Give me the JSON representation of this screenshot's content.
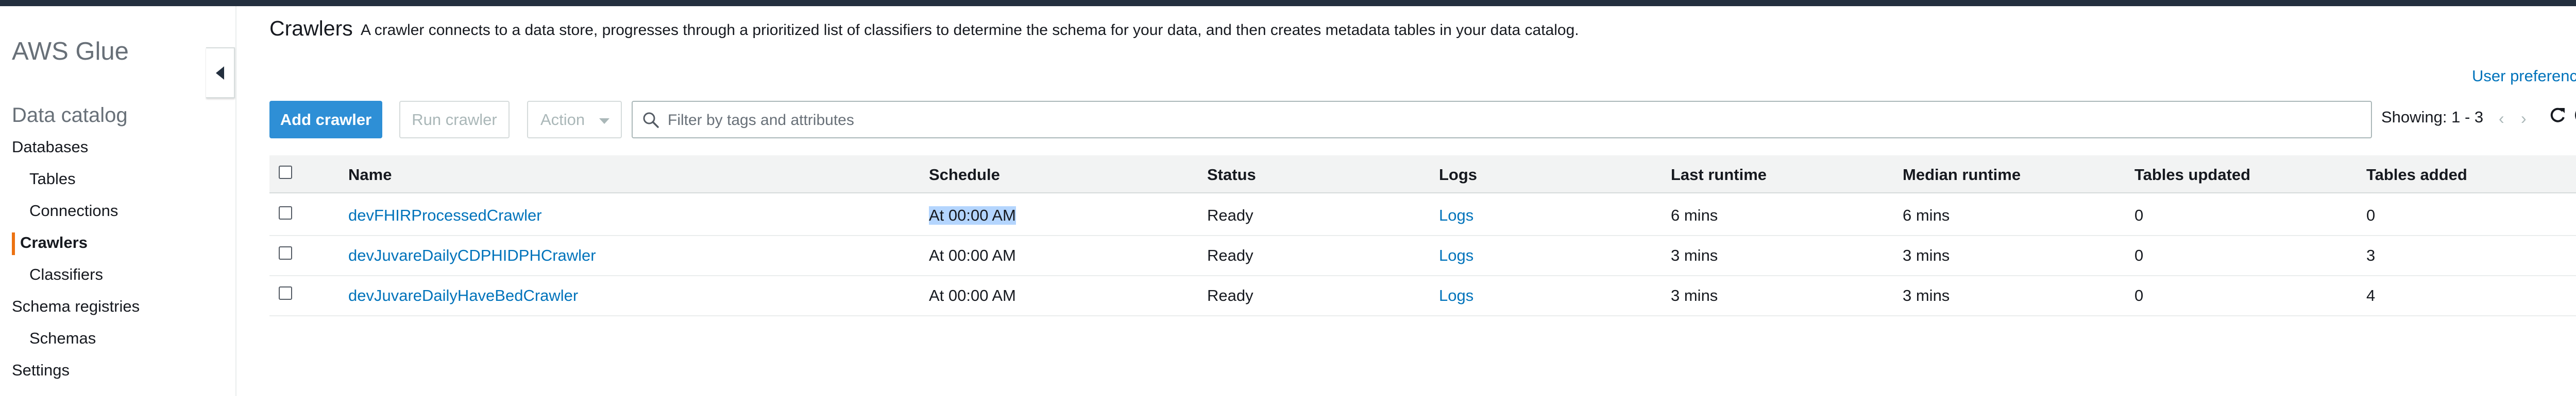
{
  "sidebar": {
    "brand": "AWS Glue",
    "section_title": "Data catalog",
    "items": [
      {
        "label": "Databases"
      },
      {
        "label": "Tables"
      },
      {
        "label": "Connections"
      },
      {
        "label": "Crawlers"
      },
      {
        "label": "Classifiers"
      },
      {
        "label": "Schema registries"
      },
      {
        "label": "Schemas"
      },
      {
        "label": "Settings"
      }
    ],
    "active_item": "Crawlers",
    "accent_color": "#ec7211"
  },
  "header": {
    "title": "Crawlers",
    "description": "A crawler connects to a data store, progresses through a prioritized list of classifiers to determine the schema for your data, and then creates metadata tables in your data catalog.",
    "user_preferences": "User preferences"
  },
  "toolbar": {
    "add_label": "Add crawler",
    "run_label": "Run crawler",
    "action_label": "Action",
    "search_placeholder": "Filter by tags and attributes",
    "search_value": "",
    "showing": "Showing: 1 - 3"
  },
  "table": {
    "columns": [
      "Name",
      "Schedule",
      "Status",
      "Logs",
      "Last runtime",
      "Median runtime",
      "Tables updated",
      "Tables added"
    ],
    "rows": [
      {
        "name": "devFHIRProcessedCrawler",
        "schedule": "At 00:00 AM",
        "status": "Ready",
        "logs": "Logs",
        "last_runtime": "6 mins",
        "median_runtime": "6 mins",
        "tables_updated": "0",
        "tables_added": "0"
      },
      {
        "name": "devJuvareDailyCDPHIDPHCrawler",
        "schedule": "At 00:00 AM",
        "status": "Ready",
        "logs": "Logs",
        "last_runtime": "3 mins",
        "median_runtime": "3 mins",
        "tables_updated": "0",
        "tables_added": "3"
      },
      {
        "name": "devJuvareDailyHaveBedCrawler",
        "schedule": "At 00:00 AM",
        "status": "Ready",
        "logs": "Logs",
        "last_runtime": "3 mins",
        "median_runtime": "3 mins",
        "tables_updated": "0",
        "tables_added": "4"
      }
    ]
  },
  "colors": {
    "link": "#0073bb",
    "primary_button": "#2e8fd6",
    "top_bar": "#232f3e",
    "selection_highlight": "#b4d5fe"
  }
}
